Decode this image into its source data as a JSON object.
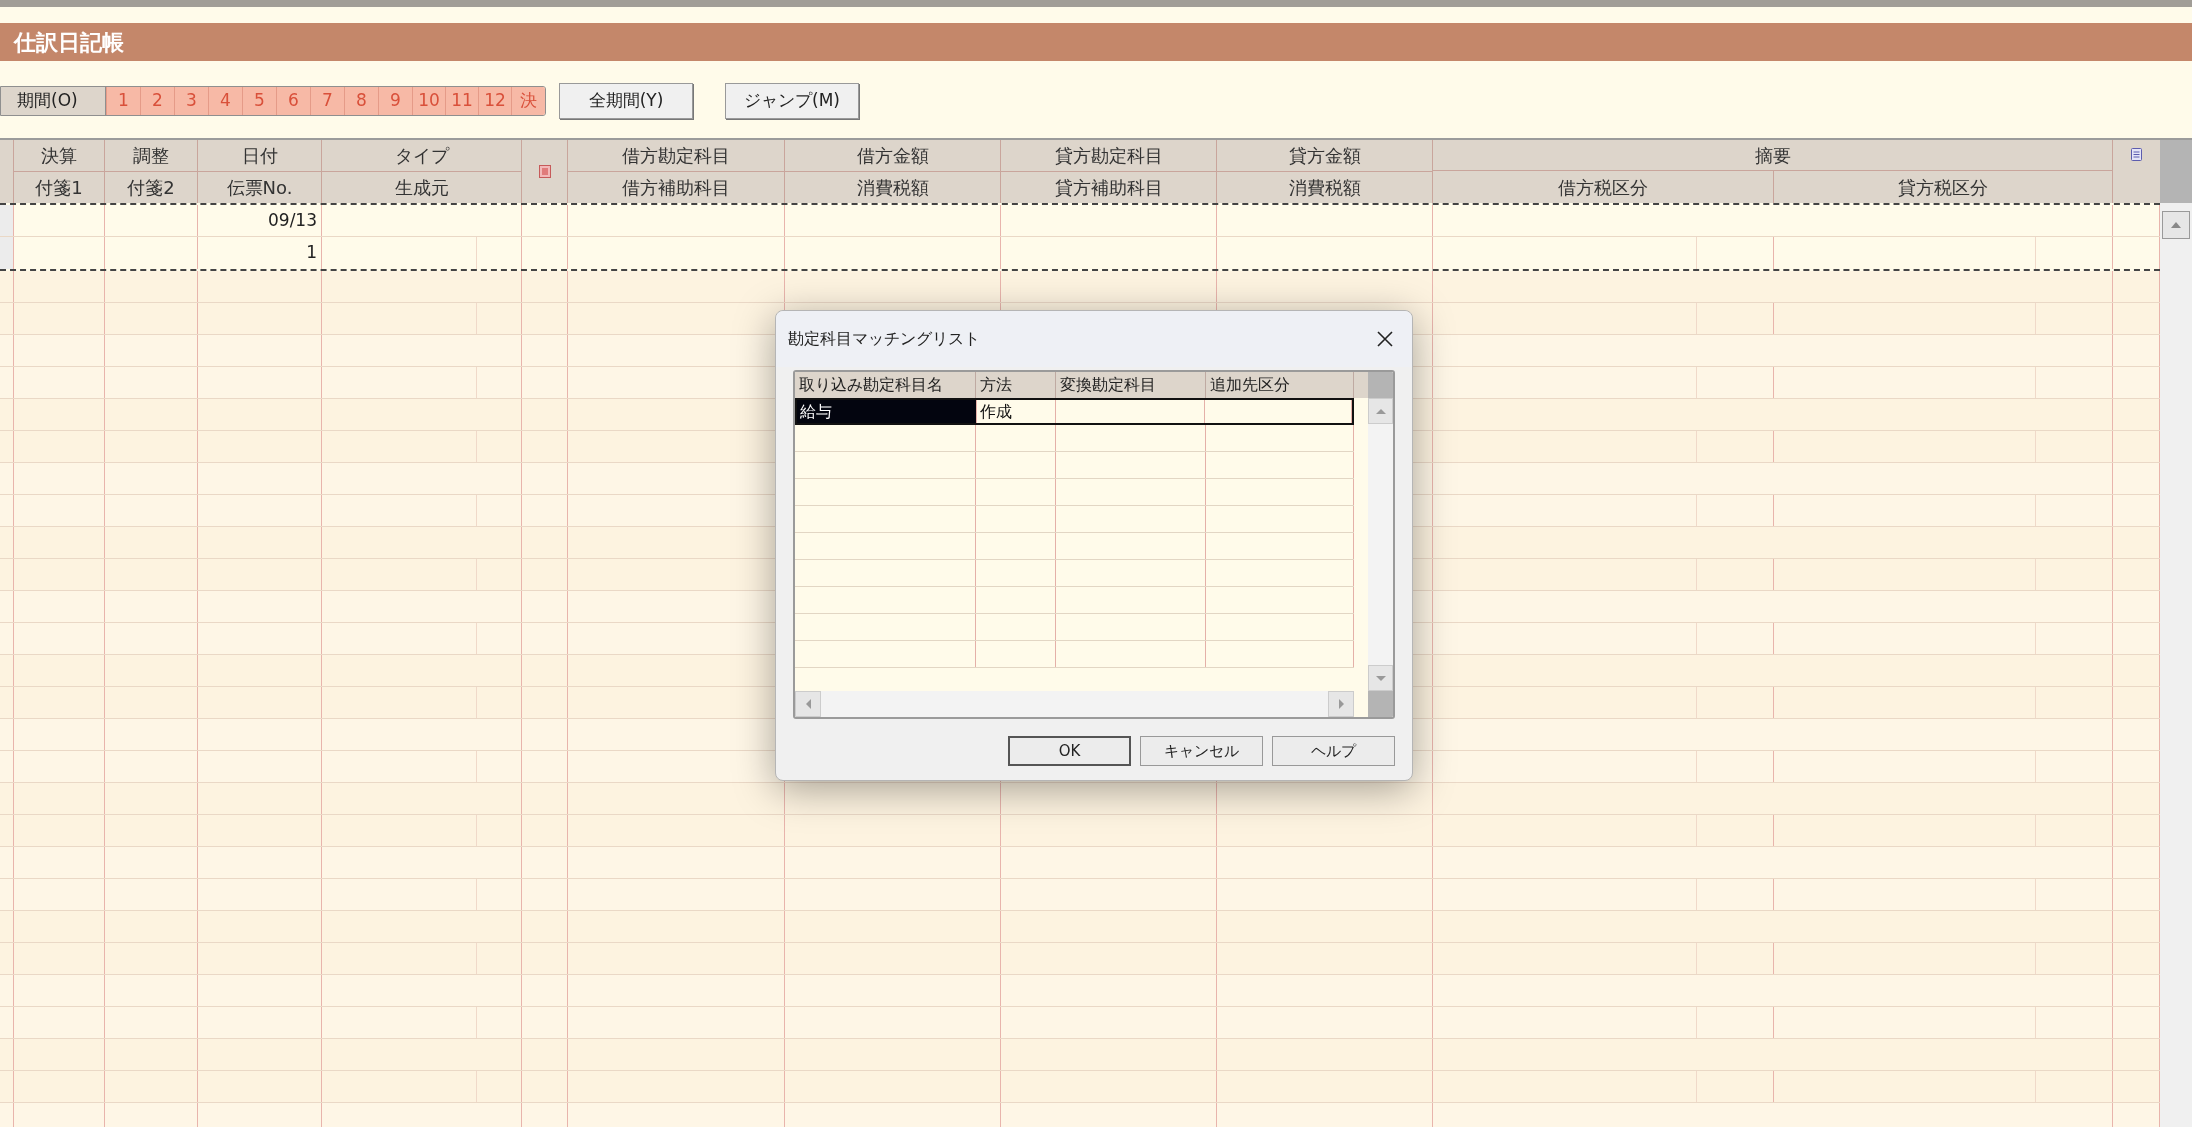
{
  "title": "仕訳日記帳",
  "period": {
    "label": "期間(O)",
    "months": [
      "1",
      "2",
      "3",
      "4",
      "5",
      "6",
      "7",
      "8",
      "9",
      "10",
      "11",
      "12",
      "決"
    ]
  },
  "buttons": [
    {
      "label": "全期間(Y)"
    },
    {
      "label": "ジャンプ(M)"
    }
  ],
  "journal": {
    "header_top": [
      "決算",
      "調整",
      "日付",
      "タイプ",
      "借方勘定科目",
      "借方金額",
      "貸方勘定科目",
      "貸方金額",
      "摘要"
    ],
    "header_bottom": [
      "付箋1",
      "付箋2",
      "伝票No.",
      "生成元",
      "借方補助科目",
      "消費税額",
      "貸方補助科目",
      "消費税額",
      "借方税区分",
      "貸方税区分"
    ],
    "entries": [
      {
        "date": "09/13",
        "voucher_no": "1",
        "focused": true
      }
    ]
  },
  "dialog": {
    "title": "勘定科目マッチングリスト",
    "columns": [
      "取り込み勘定科目名",
      "方法",
      "変換勘定科目",
      "追加先区分"
    ],
    "rows": [
      {
        "name": "給与",
        "method": "作成",
        "selected": true
      }
    ],
    "buttons": [
      "OK",
      "キャンセル",
      "ヘルプ"
    ]
  }
}
